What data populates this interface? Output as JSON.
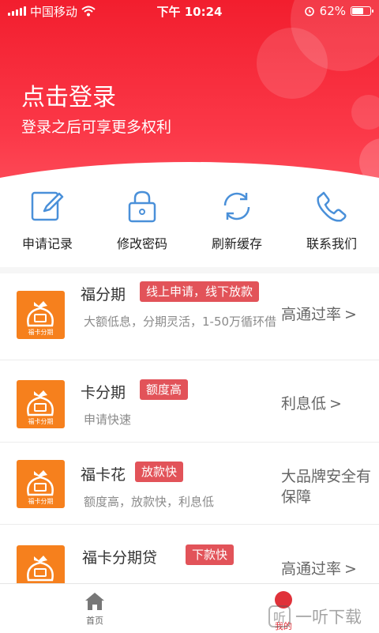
{
  "status_bar": {
    "carrier": "中国移动",
    "time": "下午 10:24",
    "battery_percent": "62%",
    "battery_level": 0.62
  },
  "header": {
    "title": "点击登录",
    "subtitle": "登录之后可享更多权利",
    "accent_color": "#f21e2e"
  },
  "actions": [
    {
      "label": "申请记录",
      "icon": "edit-icon"
    },
    {
      "label": "修改密码",
      "icon": "lock-icon"
    },
    {
      "label": "刷新缓存",
      "icon": "refresh-icon"
    },
    {
      "label": "联系我们",
      "icon": "phone-icon"
    }
  ],
  "products": [
    {
      "name": "福分期",
      "tag": "线上申请，线下放款",
      "desc": "大额低息，分期灵活，1-50万循环借",
      "side": "高通过率"
    },
    {
      "name": "卡分期",
      "tag": "额度高",
      "desc": "申请快速",
      "side": "利息低"
    },
    {
      "name": "福卡花",
      "tag": "放款快",
      "desc": "额度高，放款快，利息低",
      "side": "大品牌安全有保障"
    },
    {
      "name": "福卡分期贷",
      "tag": "下款快",
      "desc": "",
      "side": "高通过率"
    }
  ],
  "logo_text": "福卡分期",
  "tabbar": {
    "home_label": "首页",
    "mine_label": "我的"
  },
  "watermark": "一听下载"
}
